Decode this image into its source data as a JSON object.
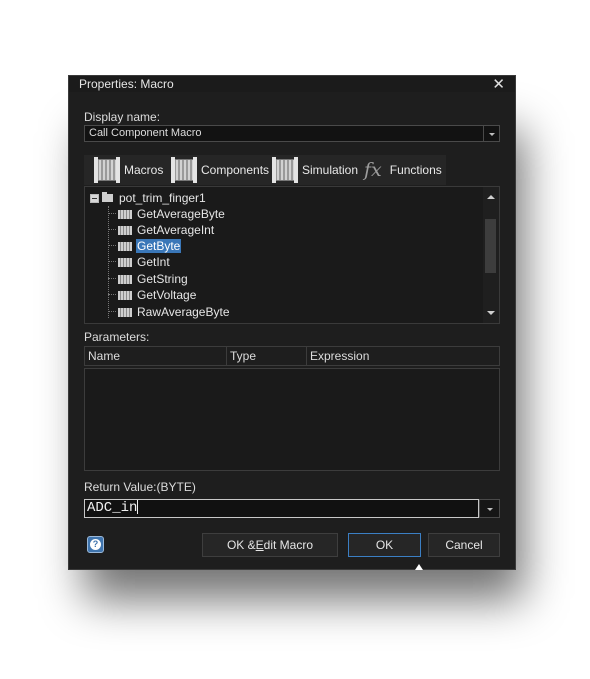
{
  "window": {
    "title": "Properties: Macro",
    "close_glyph": "✕"
  },
  "display_name": {
    "label": "Display name:",
    "value": "Call Component Macro"
  },
  "tabs": [
    {
      "label": "Macros",
      "icon": "macro-icon"
    },
    {
      "label": "Components",
      "icon": "component-icon"
    },
    {
      "label": "Simulation",
      "icon": "simulation-icon"
    },
    {
      "label": "Functions",
      "icon": "fx-icon",
      "glyph": "fx"
    }
  ],
  "tree": {
    "root": "pot_trim_finger1",
    "items": [
      "GetAverageByte",
      "GetAverageInt",
      "GetByte",
      "GetInt",
      "GetString",
      "GetVoltage",
      "RawAverageByte"
    ],
    "selected": "GetByte"
  },
  "parameters": {
    "label": "Parameters:",
    "columns": [
      "Name",
      "Type",
      "Expression"
    ],
    "rows": []
  },
  "return_value": {
    "label": "Return Value:(BYTE)",
    "value": "ADC_in"
  },
  "buttons": {
    "help_glyph": "?",
    "ok_edit": "OK & Edit Macro",
    "ok_edit_mnemonic_pre": "OK & ",
    "ok_edit_mnemonic_char": "E",
    "ok_edit_mnemonic_post": "dit Macro",
    "ok": "OK",
    "cancel": "Cancel"
  },
  "colors": {
    "dialog_bg": "#1e1e1e",
    "selection": "#3a77b8",
    "help_button": "#3f74ad",
    "default_button_border": "#3b7fc4"
  }
}
